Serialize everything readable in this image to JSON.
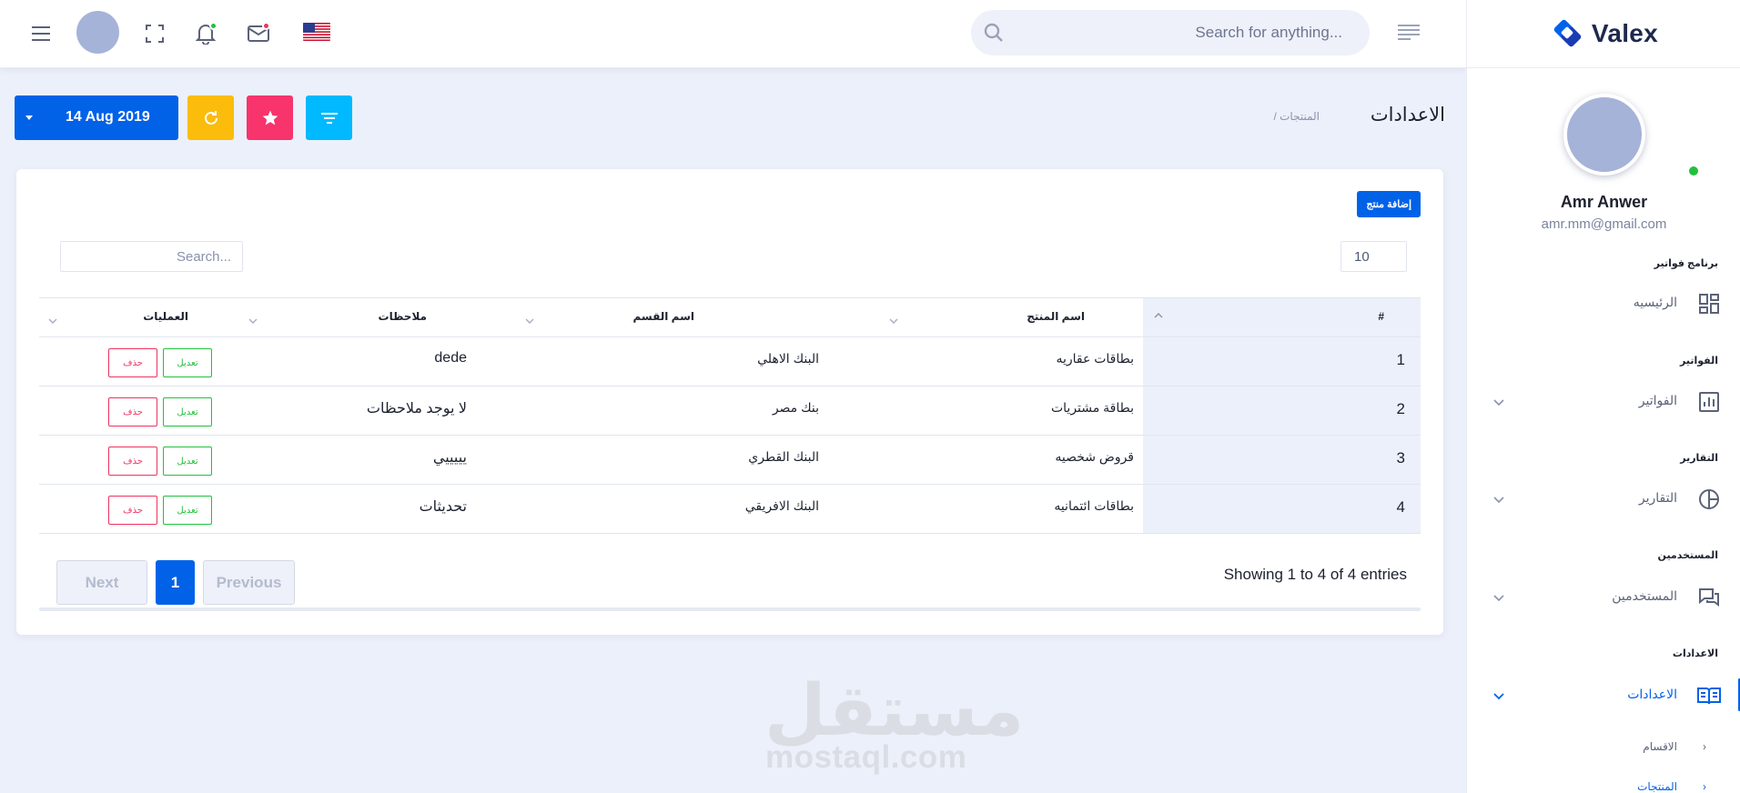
{
  "header": {
    "search_placeholder": "Search for anything...",
    "notification_dot_color": "#22c03c",
    "mail_dot_color": "#ee335e",
    "language_flag": "us-flag-icon"
  },
  "sidebar": {
    "brand": "Valex",
    "user_name": "Amr Anwer",
    "user_email": "amr.mm@gmail.com",
    "sections": [
      {
        "category": "برنامج فواتير",
        "label": "الرئيسيه",
        "icon": "dashboard-icon"
      },
      {
        "category": "الفواتير",
        "label": "الفواتير",
        "icon": "chart-icon"
      },
      {
        "category": "التقارير",
        "label": "التقارير",
        "icon": "pie-icon"
      },
      {
        "category": "المستخدمين",
        "label": "المستخدمين",
        "icon": "chat-icon"
      },
      {
        "category": "الاعدادات",
        "label": "الاعدادات",
        "icon": "book-icon"
      }
    ],
    "sub_items": [
      "الاقسام",
      "المنتجات"
    ]
  },
  "page": {
    "title": "الاعدادات",
    "breadcrumb": "/ المنتجات",
    "date_label": "14 Aug 2019"
  },
  "card": {
    "add_button": "إضافة منتج",
    "page_length": "10",
    "search_placeholder": "Search...",
    "columns": [
      "#",
      "اسم المنتج",
      "اسم القسم",
      "ملاحظات",
      "العمليات"
    ],
    "rows": [
      {
        "num": "1",
        "name": "بطاقات عقاريه",
        "section": "البنك الاهلي",
        "notes": "dede"
      },
      {
        "num": "2",
        "name": "بطاقة مشتريات",
        "section": "بنك مصر",
        "notes": "لا يوجد ملاحظات"
      },
      {
        "num": "3",
        "name": "قروض شخصيه",
        "section": "البنك القطري",
        "notes": "يييييي"
      },
      {
        "num": "4",
        "name": "بطاقات ائتمانيه",
        "section": "البنك الافريقي",
        "notes": "تحديثات"
      }
    ],
    "edit_label": "تعديل",
    "delete_label": "حذف",
    "info": "Showing 1 to 4 of 4 entries",
    "pager": {
      "next": "Next",
      "current": "1",
      "previous": "Previous"
    }
  },
  "watermark": {
    "arabic": "مستقل",
    "latin": "mostaql.com"
  },
  "colors": {
    "primary": "#0162e8",
    "warning": "#fbbc0b",
    "danger": "#f7346b",
    "info": "#00b9ff",
    "success": "#22c03c"
  }
}
